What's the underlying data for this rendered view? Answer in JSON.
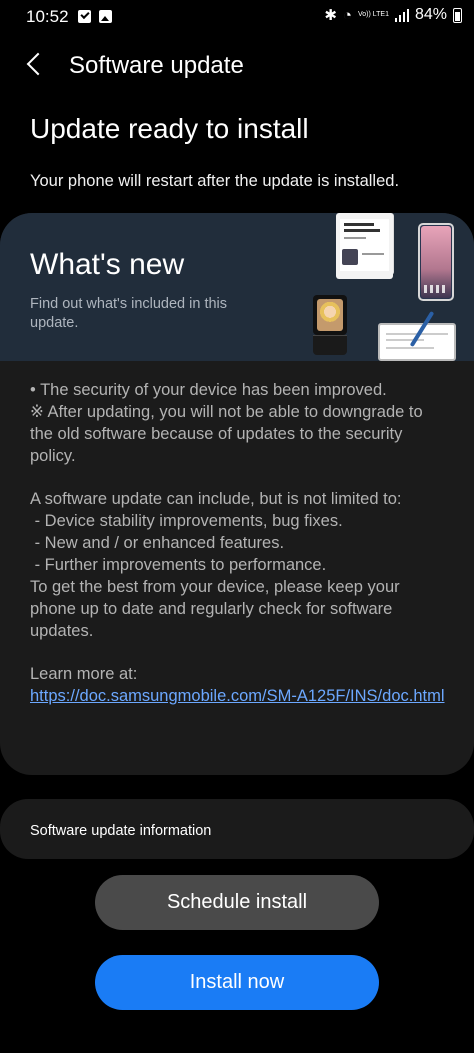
{
  "status_bar": {
    "time": "10:52",
    "left_icons": [
      "checkbox-notification-icon",
      "image-notification-icon"
    ],
    "right_icons": [
      "bluetooth-icon",
      "wifi-icon",
      "volte-icon",
      "signal-icon",
      "battery-icon"
    ],
    "volte_text": "Vo)) LTE1",
    "battery_percent": "84%"
  },
  "header": {
    "title": "Software update",
    "back_icon": "back-chevron-icon"
  },
  "main": {
    "title": "Update ready to install",
    "subtitle": "Your phone will restart after the update is installed."
  },
  "whats_new": {
    "title": "What's new",
    "subtitle": "Find out what's included in this update.",
    "security_line": "• The security of your device has been improved.",
    "downgrade_note": "※ After updating, you will not be able to downgrade to the old software because of updates to the security policy.",
    "intro": "A software update can include, but is not limited to:",
    "items": [
      " - Device stability improvements, bug fixes.",
      " - New and / or enhanced features.",
      " - Further improvements to performance."
    ],
    "closing": "To get the best from your device, please keep your phone up to date and regularly check for software updates.",
    "learn_more_label": "Learn more at:",
    "learn_more_link": "https://doc.samsungmobile.com/SM-A125F/INS/doc.html"
  },
  "info_card": {
    "title": "Software update information"
  },
  "buttons": {
    "schedule": "Schedule install",
    "install": "Install now"
  },
  "colors": {
    "background": "#000000",
    "card": "#1b1b1b",
    "banner": "#212d3b",
    "link": "#6ca8ff",
    "primary_button": "#1a7cf5",
    "secondary_button": "#4a4a4a"
  }
}
